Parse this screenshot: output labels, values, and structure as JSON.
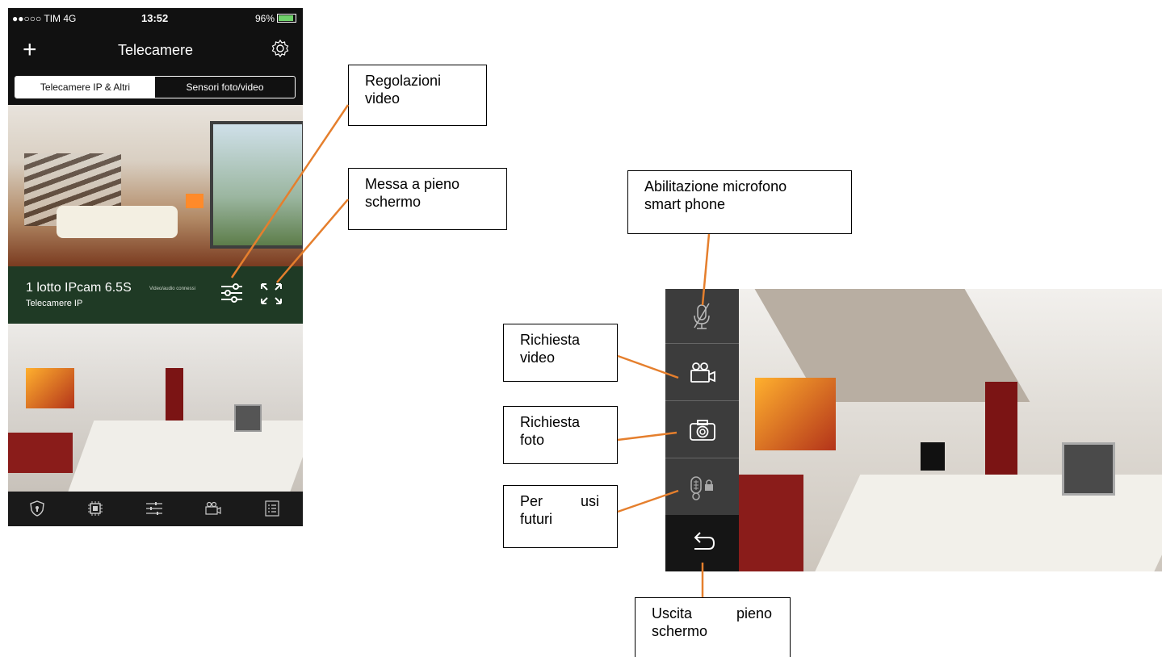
{
  "status_bar": {
    "carrier": "●●○○○ TIM  4G",
    "time": "13:52",
    "battery": "96%"
  },
  "navbar": {
    "title": "Telecamere"
  },
  "segments": [
    {
      "label": "Telecamere IP & Altri",
      "selected": true
    },
    {
      "label": "Sensori foto/video",
      "selected": false
    }
  ],
  "camera_card": {
    "name": "1 lotto IPcam 6.5S",
    "status": "Video/audio connessi",
    "group": "Telecamere IP"
  },
  "tabbar": {
    "icons": [
      "shield-icon",
      "chip-icon",
      "sliders-icon",
      "video-camera-icon",
      "list-icon"
    ]
  },
  "callouts": {
    "video_settings": "Regolazioni\nvideo",
    "fullscreen": "Messa a pieno\nschermo",
    "mic_enable": "Abilitazione  microfono\nsmart phone",
    "video_request": "Richiesta\nvideo",
    "photo_request": "Richiesta\nfoto",
    "future_use_line1": "Per      usi",
    "future_use_line2": "futuri",
    "exit_fullscreen_line1": "Uscita      pieno",
    "exit_fullscreen_line2": "schermo"
  },
  "landscape_sidebar": {
    "buttons": [
      "microphone-muted-icon",
      "video-camera-icon",
      "photo-camera-icon",
      "door-lock-icon",
      "back-arrow-icon"
    ]
  },
  "colors": {
    "leader_line": "#e57f2d",
    "info_bar": "#1f3a25"
  }
}
